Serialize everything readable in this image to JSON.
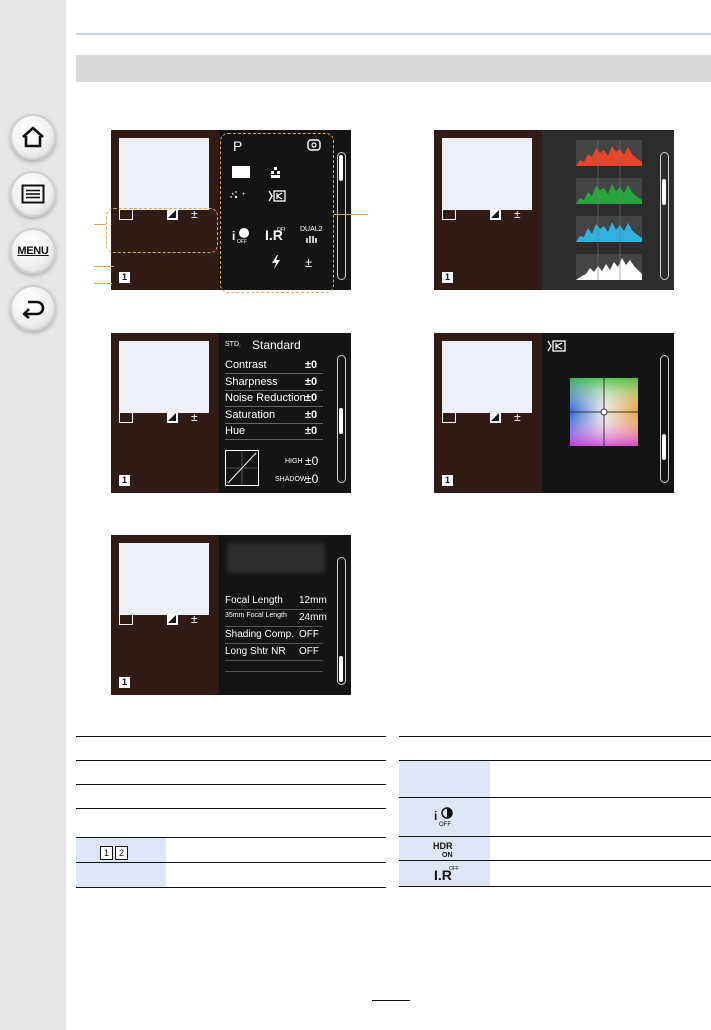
{
  "nav": {
    "home_icon": "home-icon",
    "contents_icon": "contents-list-icon",
    "menu_label": "MENU",
    "back_icon": "back-arrow-icon"
  },
  "screens": {
    "common": {
      "pm": "±",
      "one": "1"
    },
    "info": {
      "mode": "P",
      "dual2": "DUAL2",
      "pm": "±"
    },
    "photo_style": {
      "style": "Standard",
      "std": "STD.",
      "rows": [
        {
          "label": "Contrast",
          "value": "±0"
        },
        {
          "label": "Sharpness",
          "value": "±0"
        },
        {
          "label": "Noise Reduction",
          "value": "±0"
        },
        {
          "label": "Saturation",
          "value": "±0"
        },
        {
          "label": "Hue",
          "value": "±0"
        }
      ],
      "high_label": "HIGH",
      "high_value": "±0",
      "shadow_label": "SHADOW",
      "shadow_value": "±0"
    },
    "lens": {
      "rows": [
        {
          "label": "Focal Length",
          "value": "12mm"
        },
        {
          "label": "35mm Focal Length",
          "value": "24mm"
        },
        {
          "label": "Shading Comp.",
          "value": "OFF"
        },
        {
          "label": "Long Shtr NR",
          "value": "OFF"
        }
      ]
    }
  },
  "table": {
    "badge1": "1",
    "badge2": "2"
  },
  "colors": {
    "highlight": "#e3a552",
    "screen_bg": "#311c15",
    "table_shade": "#dde6f4"
  }
}
